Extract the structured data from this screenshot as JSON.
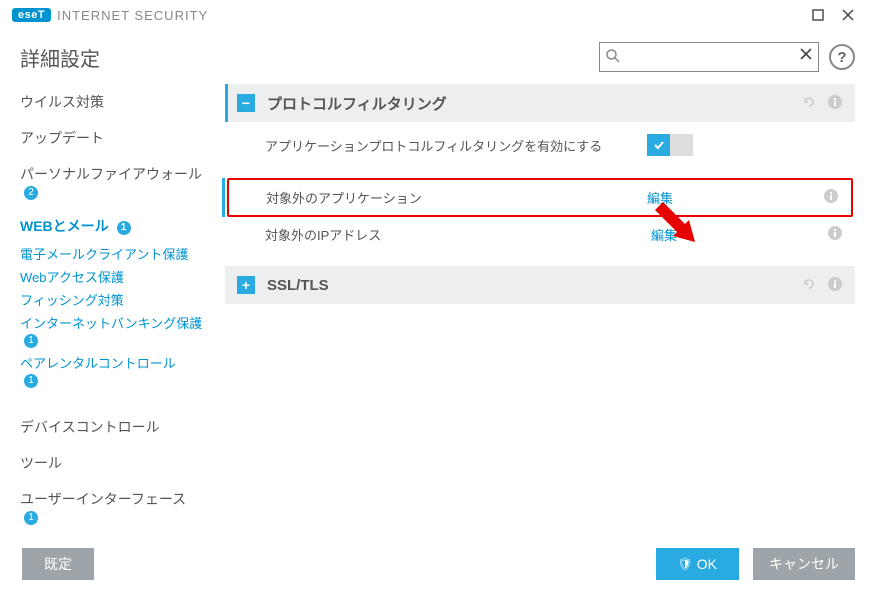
{
  "app": {
    "logo_badge": "eseT",
    "logo_text": "INTERNET SECURITY"
  },
  "page_title": "詳細設定",
  "search": {
    "placeholder": ""
  },
  "sidebar": {
    "items": [
      {
        "label": "ウイルス対策"
      },
      {
        "label": "アップデート"
      },
      {
        "label": "パーソナルファイアウォール",
        "badge": "2"
      },
      {
        "label": "WEBとメール",
        "badge": "1",
        "active": true,
        "subs": [
          {
            "label": "電子メールクライアント保護"
          },
          {
            "label": "Webアクセス保護"
          },
          {
            "label": "フィッシング対策"
          },
          {
            "label": "インターネットバンキング保護",
            "badge": "1"
          },
          {
            "label": "ペアレンタルコントロール",
            "badge": "1"
          }
        ]
      },
      {
        "label": "デバイスコントロール"
      },
      {
        "label": "ツール"
      },
      {
        "label": "ユーザーインターフェース",
        "badge": "1"
      }
    ]
  },
  "sections": {
    "protocol": {
      "title": "プロトコルフィルタリング",
      "toggle": "−",
      "rows": {
        "enable": {
          "label": "アプリケーションプロトコルフィルタリングを有効にする"
        },
        "excluded_apps": {
          "label": "対象外のアプリケーション",
          "action": "編集"
        },
        "excluded_ips": {
          "label": "対象外のIPアドレス",
          "action": "編集"
        }
      }
    },
    "ssltls": {
      "title": "SSL/TLS",
      "toggle": "+"
    }
  },
  "footer": {
    "default": "既定",
    "ok": "OK",
    "cancel": "キャンセル"
  }
}
